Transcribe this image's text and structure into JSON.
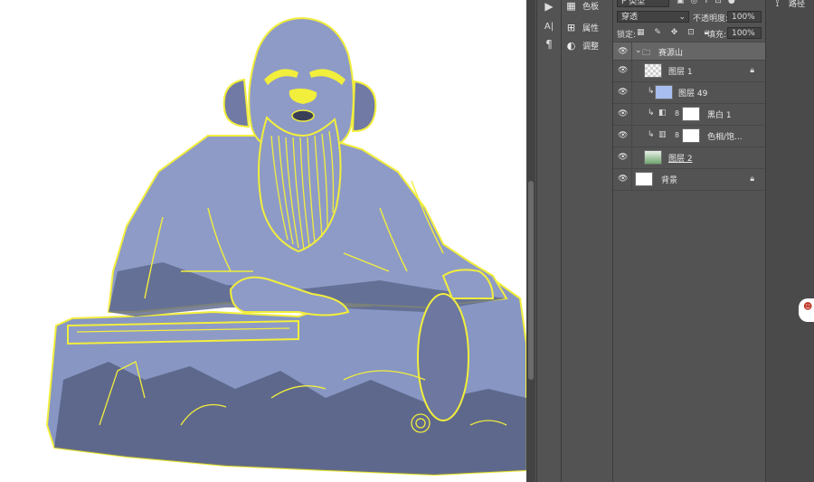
{
  "side_panel": {
    "tabs": [
      {
        "icon": "grid-icon",
        "label": "色板"
      },
      {
        "icon": "properties-icon",
        "label": "属性"
      },
      {
        "icon": "adjustments-icon",
        "label": "调整"
      }
    ]
  },
  "right_strip": {
    "paths_label": "路径"
  },
  "layers_panel": {
    "filter_value": "P 类型",
    "blend_mode": "穿透",
    "opacity_label": "不透明度:",
    "opacity_value": "100%",
    "lock_label": "锁定:",
    "fill_label": "填充:",
    "fill_value": "100%",
    "layers": [
      {
        "name": "赛源山",
        "type": "group"
      },
      {
        "name": "图层 1",
        "type": "pixel",
        "locked": true
      },
      {
        "name": "图层 49",
        "type": "pixel",
        "clipped": true
      },
      {
        "name": "黑白 1",
        "type": "adjustment",
        "clipped": true
      },
      {
        "name": "色相/饱...",
        "type": "adjustment",
        "clipped": true
      },
      {
        "name": "图层 2",
        "type": "pixel"
      },
      {
        "name": "背景",
        "type": "background",
        "locked": true
      }
    ]
  },
  "colors": {
    "statue_fill": "#8e9bc7",
    "statue_shadow": "#545d7e",
    "outline": "#f2ee3c",
    "panel_bg": "#535353",
    "selected_group": "#666666"
  }
}
